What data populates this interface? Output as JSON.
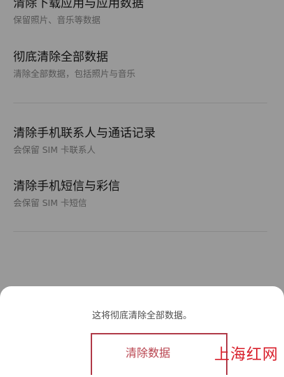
{
  "settings": {
    "items": [
      {
        "title": "清除下载应用与应用数据",
        "subtitle": "保留照片、音乐等数据"
      },
      {
        "title": "彻底清除全部数据",
        "subtitle": "清除全部数据，包括照片与音乐"
      },
      {
        "title": "清除手机联系人与通话记录",
        "subtitle": "会保留 SIM 卡联系人"
      },
      {
        "title": "清除手机短信与彩信",
        "subtitle": "会保留 SIM 卡短信"
      }
    ]
  },
  "dialog": {
    "message": "这将彻底清除全部数据。",
    "confirm_label": "清除数据"
  },
  "watermark": {
    "text": "上海红网"
  },
  "colors": {
    "overlay": "#000000",
    "accent": "#b8434e",
    "watermark": "#d81e2a"
  }
}
